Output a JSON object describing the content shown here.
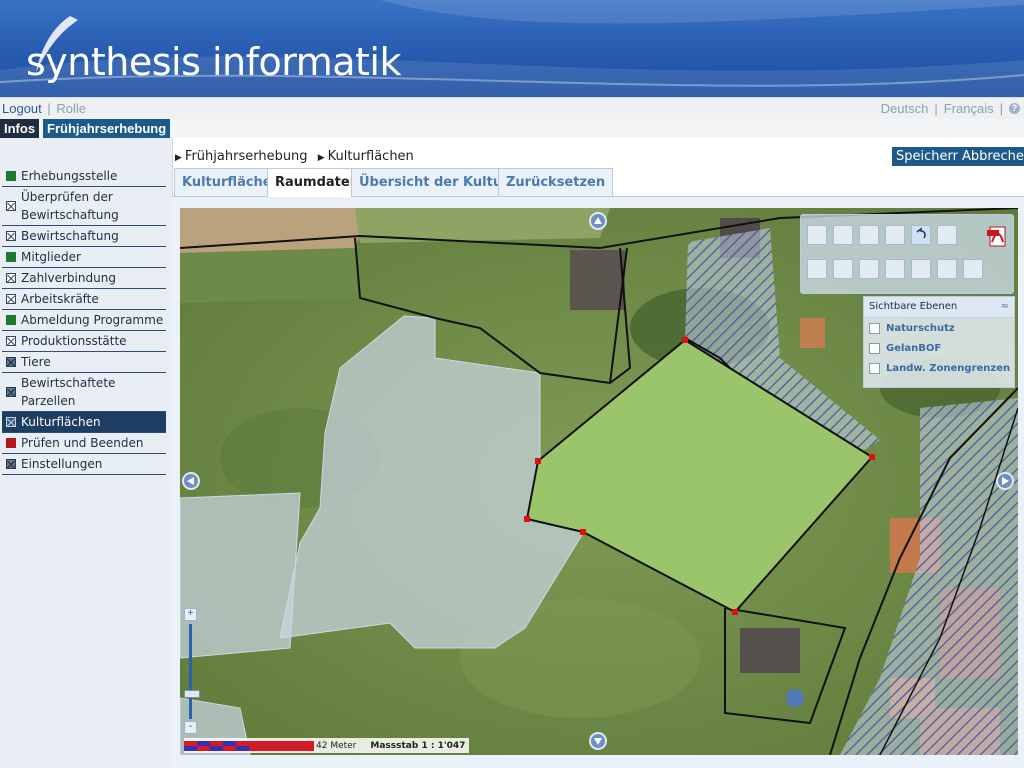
{
  "banner": {
    "logo": "synthesis informatik"
  },
  "topnav": {
    "logout": "Logout",
    "role": "Rolle",
    "lang_de": "Deutsch",
    "lang_fr": "Français",
    "sep": "|"
  },
  "crumbtabs": {
    "infos": "Infos",
    "season": "Frühjahrserhebung"
  },
  "sidebar": {
    "items": [
      {
        "label": "Erhebungsstelle",
        "icon": "green-square"
      },
      {
        "label": "Überprüfen der Bewirtschaftung",
        "icon": "checkbox-crossed"
      },
      {
        "label": "Bewirtschaftung",
        "icon": "checkbox-crossed"
      },
      {
        "label": "Mitglieder",
        "icon": "green-square"
      },
      {
        "label": "Zahlverbindung",
        "icon": "checkbox-crossed"
      },
      {
        "label": "Arbeitskräfte",
        "icon": "checkbox-crossed"
      },
      {
        "label": "Abmeldung Programme",
        "icon": "green-square"
      },
      {
        "label": "Produktionsstätte",
        "icon": "checkbox-crossed"
      },
      {
        "label": "Tiere",
        "icon": "checkbox-crossed-dark"
      },
      {
        "label": "Bewirtschaftete Parzellen",
        "icon": "checkbox-crossed-dark"
      },
      {
        "label": "Kulturflächen",
        "icon": "checkbox-crossed"
      },
      {
        "label": "Prüfen und Beenden",
        "icon": "red-square"
      },
      {
        "label": "Einstellungen",
        "icon": "checkbox-crossed-dark"
      }
    ]
  },
  "breadcrumb": {
    "part1": "Frühjahrserhebung",
    "part2": "Kulturflächen"
  },
  "actions": {
    "save": "Speichern",
    "cancel": "Abbrechen"
  },
  "tabs": [
    {
      "label": "Kulturflächen"
    },
    {
      "label": "Raumdaten"
    },
    {
      "label": "Übersicht der Kulturen"
    },
    {
      "label": "Zurücksetzen"
    }
  ],
  "map": {
    "layers_panel": {
      "title": "Sichtbare Ebenen",
      "layers": [
        "Naturschutz",
        "GelanBOF",
        "Landw. Zonengrenzen"
      ]
    },
    "scale": {
      "distance": "42 Meter",
      "ratio": "Massstab 1 : 1'047"
    },
    "colors": {
      "selected_parcel": "#9bc56a",
      "vertex": "#e01010",
      "hatch": "#3f5da8"
    }
  }
}
